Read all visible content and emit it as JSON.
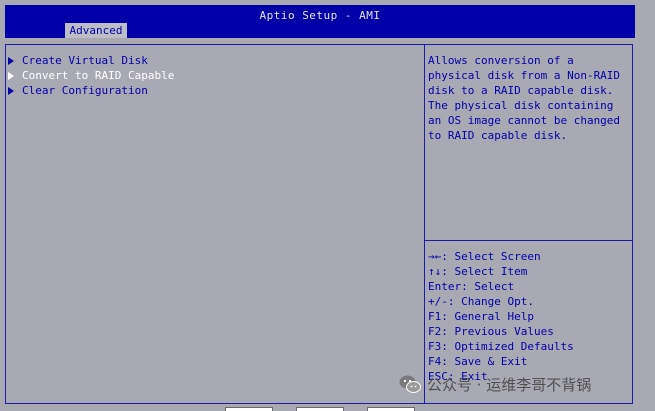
{
  "header": {
    "title": "Aptio Setup - AMI",
    "tab_label": "Advanced"
  },
  "menu": {
    "items": [
      {
        "label": "Create Virtual Disk",
        "selected": false
      },
      {
        "label": "Convert to RAID Capable",
        "selected": true
      },
      {
        "label": "Clear Configuration",
        "selected": false
      }
    ]
  },
  "help": {
    "lines": [
      "Allows conversion of a",
      "physical disk from a Non-RAID",
      "disk to a RAID capable disk.",
      "The physical disk containing",
      "an OS image cannot be changed",
      "to RAID capable disk."
    ]
  },
  "keys": {
    "lines": [
      "→←: Select Screen",
      "↑↓: Select Item",
      "Enter: Select",
      "+/-: Change Opt.",
      "F1: General Help",
      "F2: Previous Values",
      "F3: Optimized Defaults",
      "F4: Save & Exit",
      "ESC: Exit"
    ]
  },
  "watermark": {
    "text": "公众号 · 运维李哥不背锅",
    "icon": "wechat-icon"
  },
  "colors": {
    "background": "#a9a9b4",
    "header": "#0000a8",
    "text": "#0000a8",
    "selected_text": "#ffffff"
  }
}
